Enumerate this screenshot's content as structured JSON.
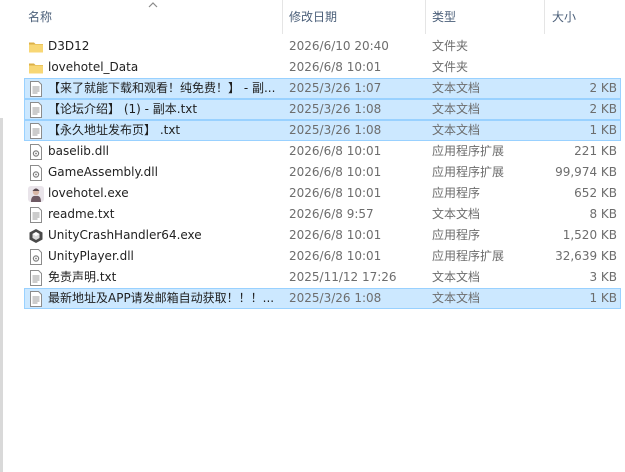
{
  "columns": {
    "name": "名称",
    "date": "修改日期",
    "type": "类型",
    "size": "大小"
  },
  "files": [
    {
      "name": "D3D12",
      "date": "2026/6/10 20:40",
      "type": "文件夹",
      "size": "",
      "icon": "folder-icon",
      "selected": false
    },
    {
      "name": "lovehotel_Data",
      "date": "2026/6/8 10:01",
      "type": "文件夹",
      "size": "",
      "icon": "folder-icon",
      "selected": false
    },
    {
      "name": "【来了就能下载和观看！纯免费！】 - 副...",
      "date": "2025/3/26 1:07",
      "type": "文本文档",
      "size": "2 KB",
      "icon": "text-file-icon",
      "selected": true
    },
    {
      "name": "【论坛介绍】 (1) - 副本.txt",
      "date": "2025/3/26 1:08",
      "type": "文本文档",
      "size": "2 KB",
      "icon": "text-file-icon",
      "selected": true
    },
    {
      "name": "【永久地址发布页】 .txt",
      "date": "2025/3/26 1:08",
      "type": "文本文档",
      "size": "1 KB",
      "icon": "text-file-icon",
      "selected": true
    },
    {
      "name": "baselib.dll",
      "date": "2026/6/8 10:01",
      "type": "应用程序扩展",
      "size": "221 KB",
      "icon": "dll-file-icon",
      "selected": false
    },
    {
      "name": "GameAssembly.dll",
      "date": "2026/6/8 10:01",
      "type": "应用程序扩展",
      "size": "99,974 KB",
      "icon": "dll-file-icon",
      "selected": false
    },
    {
      "name": "lovehotel.exe",
      "date": "2026/6/8 10:01",
      "type": "应用程序",
      "size": "652 KB",
      "icon": "app-avatar-icon",
      "selected": false
    },
    {
      "name": "readme.txt",
      "date": "2026/6/8 9:57",
      "type": "文本文档",
      "size": "8 KB",
      "icon": "text-file-icon",
      "selected": false
    },
    {
      "name": "UnityCrashHandler64.exe",
      "date": "2026/6/8 10:01",
      "type": "应用程序",
      "size": "1,520 KB",
      "icon": "unity-icon",
      "selected": false
    },
    {
      "name": "UnityPlayer.dll",
      "date": "2026/6/8 10:01",
      "type": "应用程序扩展",
      "size": "32,639 KB",
      "icon": "dll-file-icon",
      "selected": false
    },
    {
      "name": "免责声明.txt",
      "date": "2025/11/12 17:26",
      "type": "文本文档",
      "size": "3 KB",
      "icon": "text-file-icon",
      "selected": false
    },
    {
      "name": "最新地址及APP请发邮箱自动获取！！！...",
      "date": "2025/3/26 1:08",
      "type": "文本文档",
      "size": "1 KB",
      "icon": "text-file-icon",
      "selected": true
    }
  ]
}
